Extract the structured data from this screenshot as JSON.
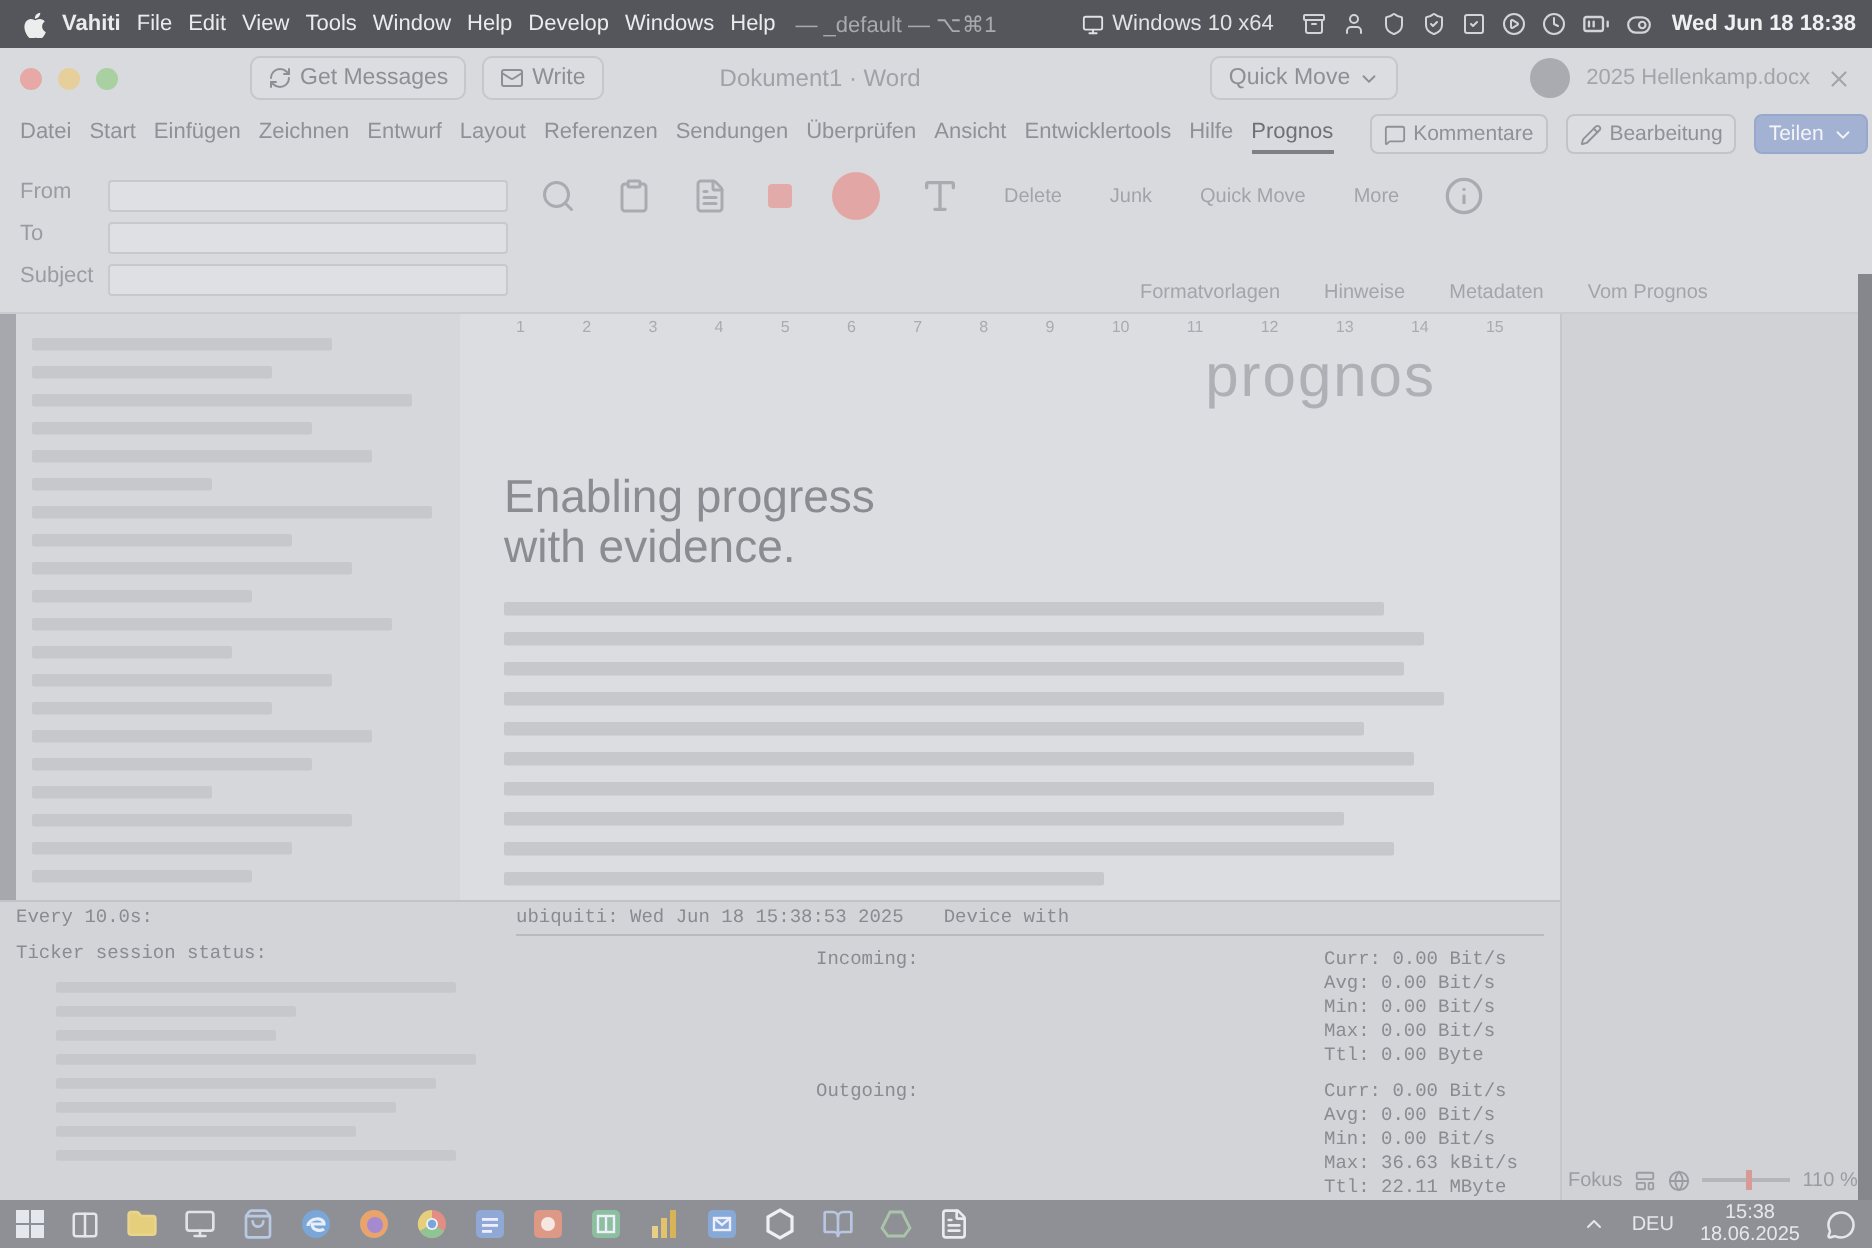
{
  "menu_bar": {
    "app_name": "Vahiti",
    "menus": [
      "File",
      "Edit",
      "View",
      "Tools",
      "Window",
      "Help",
      "Develop",
      "Windows",
      "Help"
    ],
    "window_title": "— _default — ⌥⌘1",
    "vm_name": "Windows 10 x64",
    "clock": "Wed Jun 18 18:38"
  },
  "mail_toolbar": {
    "buttons": [
      {
        "kind": "get_messages",
        "label": "Get Messages"
      },
      {
        "kind": "write",
        "label": "Write"
      }
    ],
    "document_title": "Dokument1 · Word",
    "quick_move": "Quick Move",
    "recent_file": "2025 Hellenkamp.docx"
  },
  "ribbon": {
    "tabs": [
      {
        "label": "Datei",
        "selected": false
      },
      {
        "label": "Start",
        "selected": false
      },
      {
        "label": "Einfügen",
        "selected": false
      },
      {
        "label": "Zeichnen",
        "selected": false
      },
      {
        "label": "Entwurf",
        "selected": false
      },
      {
        "label": "Layout",
        "selected": false
      },
      {
        "label": "Referenzen",
        "selected": false
      },
      {
        "label": "Sendungen",
        "selected": false
      },
      {
        "label": "Überprüfen",
        "selected": false
      },
      {
        "label": "Ansicht",
        "selected": false
      },
      {
        "label": "Entwicklertools",
        "selected": false
      },
      {
        "label": "Hilfe",
        "selected": false
      },
      {
        "label": "Prognos",
        "selected": true
      }
    ],
    "buttons": [
      {
        "kind": "comments",
        "label": "Kommentare"
      },
      {
        "kind": "editing",
        "label": "Bearbeitung"
      },
      {
        "kind": "share",
        "label": "Teilen"
      }
    ],
    "mail_actions": [
      "Delete",
      "Junk",
      "Quick Move",
      "More"
    ],
    "groups": [
      "Formatvorlagen",
      "Hinweise",
      "Metadaten",
      "Vom Prognos"
    ]
  },
  "compose_fields": [
    {
      "label": "From"
    },
    {
      "label": "To"
    },
    {
      "label": "Subject"
    }
  ],
  "ruler": [
    "1",
    "2",
    "3",
    "4",
    "5",
    "6",
    "7",
    "8",
    "9",
    "10",
    "11",
    "12",
    "13",
    "14",
    "15"
  ],
  "document": {
    "logo": "prognos",
    "heading": [
      "Enabling progress",
      "with evidence."
    ]
  },
  "terminal": {
    "watch_header": "Every 10.0s:",
    "status_title": "Ticker session status:",
    "host_line": "ubiquiti: Wed Jun 18 15:38:53 2025",
    "device": "Device with",
    "sections": [
      {
        "title": "Incoming:",
        "stats": [
          "Curr: 0.00 Bit/s",
          "Avg: 0.00 Bit/s",
          "Min: 0.00 Bit/s",
          "Max: 0.00 Bit/s",
          "Ttl: 0.00 Byte"
        ]
      },
      {
        "title": "Outgoing:",
        "stats": [
          "Curr: 0.00 Bit/s",
          "Avg: 0.00 Bit/s",
          "Min: 0.00 Bit/s",
          "Max: 36.63 kBit/s",
          "Ttl: 22.11 MByte"
        ]
      }
    ]
  },
  "word_status": {
    "focus": "Fokus",
    "zoom_slider": {
      "level": 0.52
    },
    "zoom": "110 %"
  },
  "taskbar": {
    "apps": [
      {
        "kind": "start"
      },
      {
        "kind": "taskview"
      },
      {
        "kind": "explorer"
      },
      {
        "kind": "monitor"
      },
      {
        "kind": "store"
      },
      {
        "kind": "edge"
      },
      {
        "kind": "firefox"
      },
      {
        "kind": "chrome"
      },
      {
        "kind": "word"
      },
      {
        "kind": "powerpoint"
      },
      {
        "kind": "excel"
      },
      {
        "kind": "powerbi"
      },
      {
        "kind": "outlook"
      },
      {
        "kind": "hexagon"
      },
      {
        "kind": "notes"
      },
      {
        "kind": "drive"
      },
      {
        "kind": "file"
      }
    ],
    "language": "DEU",
    "time": "15:38",
    "date": "18.06.2025"
  }
}
